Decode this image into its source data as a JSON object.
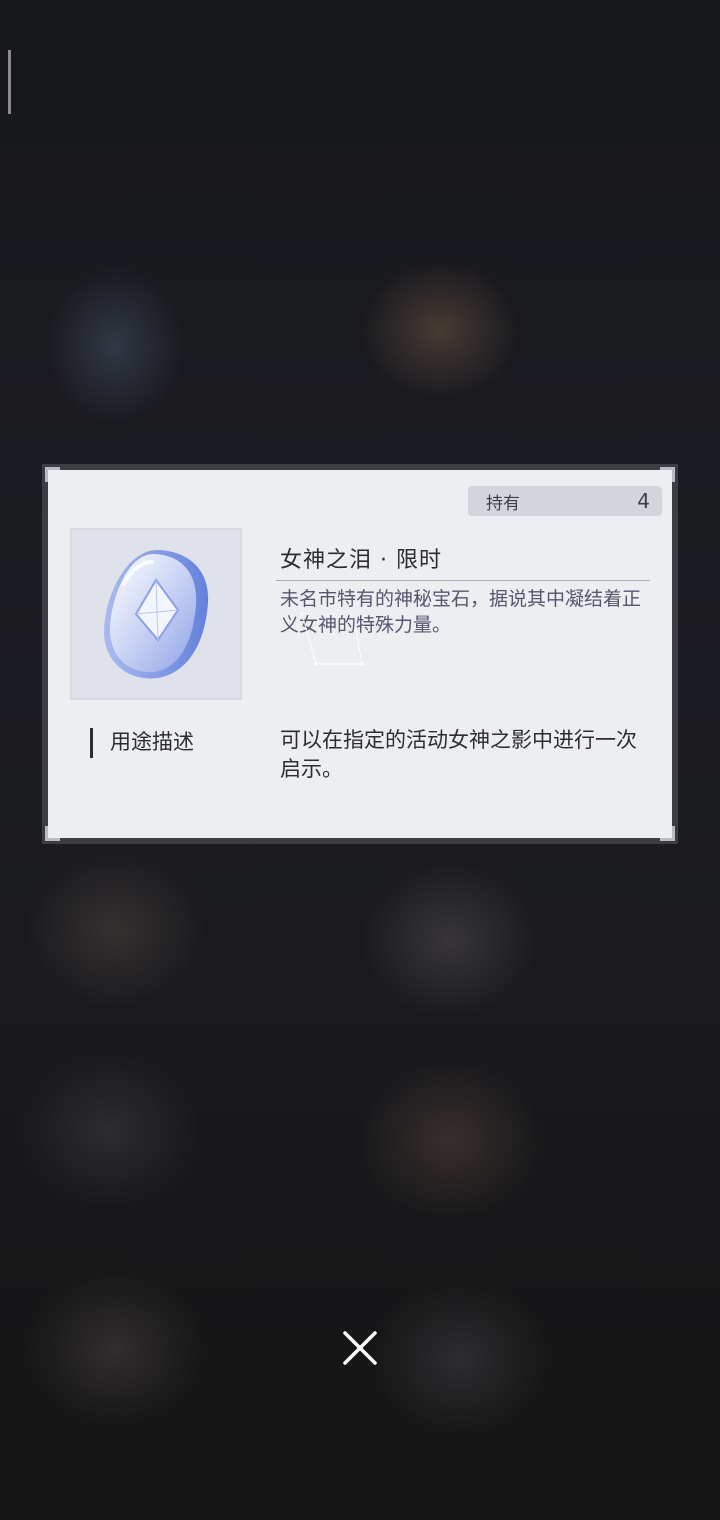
{
  "item": {
    "owned_label": "持有",
    "owned_count": "4",
    "title": "女神之泪 · 限时",
    "description": "未名市特有的神秘宝石，据说其中凝结着正义女神的特殊力量。",
    "icon": "blue-gem-icon"
  },
  "usage": {
    "label": "用途描述",
    "text": "可以在指定的活动女神之影中进行一次启示。"
  },
  "controls": {
    "close_icon": "close-icon"
  }
}
